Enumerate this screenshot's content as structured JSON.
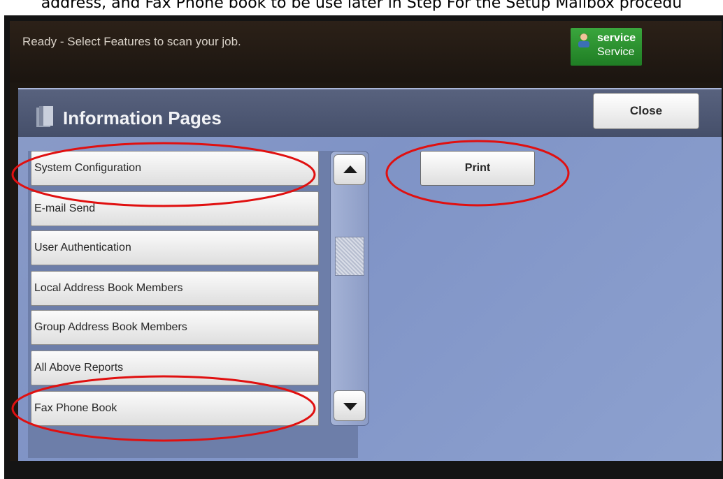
{
  "caption": "address, and Fax Phone book to be use later in Step  For the  Setup Mailbox  procedu",
  "status": {
    "message": "Ready -  Select Features to scan your job."
  },
  "user": {
    "name": "service",
    "role": "Service"
  },
  "panel": {
    "title": "Information Pages",
    "close_label": "Close",
    "print_label": "Print"
  },
  "list": {
    "items": [
      {
        "label": "System Configuration"
      },
      {
        "label": "E-mail Send"
      },
      {
        "label": "User Authentication"
      },
      {
        "label": "Local Address Book Members"
      },
      {
        "label": "Group Address Book Members"
      },
      {
        "label": "All Above Reports"
      },
      {
        "label": "Fax Phone Book"
      }
    ]
  },
  "colors": {
    "annotation_ring": "#e01010",
    "badge_green": "#2e9a33",
    "panel_blue": "#8597c7"
  }
}
